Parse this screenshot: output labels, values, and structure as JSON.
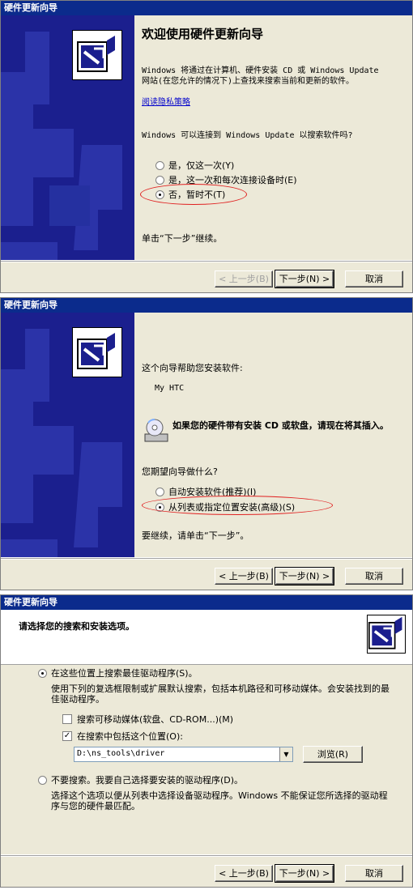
{
  "panel1": {
    "title": "硬件更新向导",
    "heading": "欢迎使用硬件更新向导",
    "intro": "Windows 将通过在计算机、硬件安装 CD 或 Windows Update 网站(在您允许的情况下)上查找来搜索当前和更新的软件。",
    "privacy_link": "阅读隐私策略",
    "question": "Windows 可以连接到 Windows Update 以搜索软件吗?",
    "options": [
      "是，仅这一次(Y)",
      "是，这一次和每次连接设备时(E)",
      "否，暂时不(T)"
    ],
    "selected": 2,
    "footer": "单击“下一步”继续。",
    "buttons": {
      "back": "< 上一步(B)",
      "next": "下一步(N) >",
      "cancel": "取消"
    }
  },
  "panel2": {
    "title": "硬件更新向导",
    "intro": "这个向导帮助您安装软件:",
    "device": "My HTC",
    "cd_prompt": "如果您的硬件带有安装 CD 或软盘，请现在将其插入。",
    "question": "您期望向导做什么?",
    "options": [
      "自动安装软件(推荐)(I)",
      "从列表或指定位置安装(高级)(S)"
    ],
    "selected": 1,
    "footer": "要继续，请单击“下一步”。",
    "buttons": {
      "back": "< 上一步(B)",
      "next": "下一步(N) >",
      "cancel": "取消"
    }
  },
  "panel3": {
    "title": "硬件更新向导",
    "heading": "请选择您的搜索和安装选项。",
    "option_search": "在这些位置上搜索最佳驱动程序(S)。",
    "option_search_desc": "使用下列的复选框限制或扩展默认搜索，包括本机路径和可移动媒体。会安装找到的最佳驱动程序。",
    "check_removable": "搜索可移动媒体(软盘、CD-ROM...)(M)",
    "check_removable_checked": false,
    "check_location": "在搜索中包括这个位置(O):",
    "check_location_checked": true,
    "path_value": "D:\\ns_tools\\driver",
    "browse": "浏览(R)",
    "option_nosearch": "不要搜索。我要自己选择要安装的驱动程序(D)。",
    "option_nosearch_desc": "选择这个选项以便从列表中选择设备驱动程序。Windows 不能保证您所选择的驱动程序与您的硬件最匹配。",
    "selected": 0,
    "buttons": {
      "back": "< 上一步(B)",
      "next": "下一步(N) >",
      "cancel": "取消"
    }
  },
  "colors": {
    "titlebar": "#0b2b8c",
    "sidebar": "#1b1f8e",
    "dialog": "#ece9d8",
    "highlight_ring": "#e02020"
  },
  "icons": [
    "hardware-wizard-icon",
    "cd-drive-icon",
    "combo-arrow-icon"
  ]
}
